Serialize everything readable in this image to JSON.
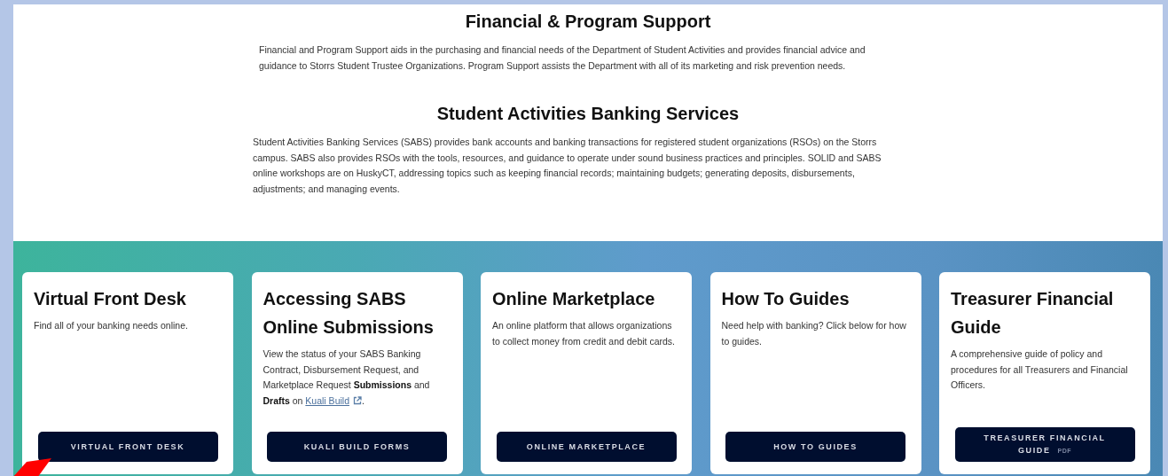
{
  "sections": [
    {
      "heading": "Financial & Program Support",
      "text": "Financial and Program Support aids in the purchasing and financial needs of the Department of Student Activities and provides financial advice and guidance to Storrs Student Trustee Organizations. Program Support assists the Department with all of its marketing and risk prevention needs."
    },
    {
      "heading": "Student Activities Banking Services",
      "text": "Student Activities Banking Services (SABS) provides bank accounts and banking transactions for registered student organizations (RSOs) on the Storrs campus. SABS also provides RSOs with the tools, resources, and guidance to operate under sound business practices and principles. SOLID and SABS online workshops are on HuskyCT, addressing topics such as keeping financial records; maintaining budgets; generating deposits, disbursements, adjustments; and managing events."
    }
  ],
  "cards": [
    {
      "title": "Virtual Front Desk",
      "description": "Find all of your banking needs online.",
      "button": "VIRTUAL FRONT DESK"
    },
    {
      "title": "Accessing SABS Online Submissions",
      "description": "View the status of your SABS Banking Contract, Disbursement Request, and Marketplace Request **Submissions** and **Drafts** on ",
      "link": "Kuali Build",
      "description_end": ".",
      "button": "KUALI BUILD FORMS"
    },
    {
      "title": "Online Marketplace",
      "description": "An online platform that allows organizations to collect money from credit and debit cards.",
      "button": "ONLINE MARKETPLACE"
    },
    {
      "title": "How To Guides",
      "description": "Need help with banking? Click below for how to guides.",
      "button": "HOW TO GUIDES"
    },
    {
      "title": "Treasurer Financial Guide",
      "description": "A comprehensive guide of policy and procedures for all Treasurers and Financial Officers.",
      "button": "TREASURER FINANCIAL GUIDE",
      "badge": "PDF"
    }
  ]
}
